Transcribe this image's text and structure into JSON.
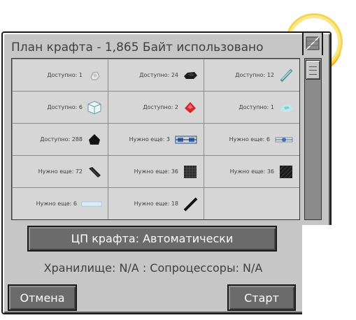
{
  "window": {
    "title": "План крафта - 1,865 Байт использовано"
  },
  "items": [
    {
      "label": "Доступно: 1",
      "icon": "iron-nugget-icon"
    },
    {
      "label": "Доступно: 24",
      "icon": "coal-icon"
    },
    {
      "label": "Доступно: 12",
      "icon": "glass-rod-icon"
    },
    {
      "label": "Доступно: 6",
      "icon": "glass-block-icon"
    },
    {
      "label": "Доступно: 2",
      "icon": "redstone-icon"
    },
    {
      "label": "Доступно: 1",
      "icon": "diamond-dust-icon"
    },
    {
      "label": "Доступно: 288",
      "icon": "coal-dust-icon"
    },
    {
      "label": "Нужно еще: 3",
      "icon": "processor-icon"
    },
    {
      "label": "Нужно еще: 6",
      "icon": "circuit-icon"
    },
    {
      "label": "Нужно еще: 72",
      "icon": "carbon-fiber-icon"
    },
    {
      "label": "Нужно еще: 36",
      "icon": "carbon-mesh-icon"
    },
    {
      "label": "Нужно еще: 36",
      "icon": "carbon-plate-icon"
    },
    {
      "label": "Нужно еще: 6",
      "icon": "glass-pane-icon"
    },
    {
      "label": "Нужно еще: 18",
      "icon": "black-rod-icon"
    }
  ],
  "cpu": {
    "label": "ЦП крафта: Автоматически"
  },
  "status": {
    "storage": "Хранилище: N/A : Сопроцессоры: N/A"
  },
  "buttons": {
    "cancel": "Отмена",
    "start": "Старт"
  }
}
